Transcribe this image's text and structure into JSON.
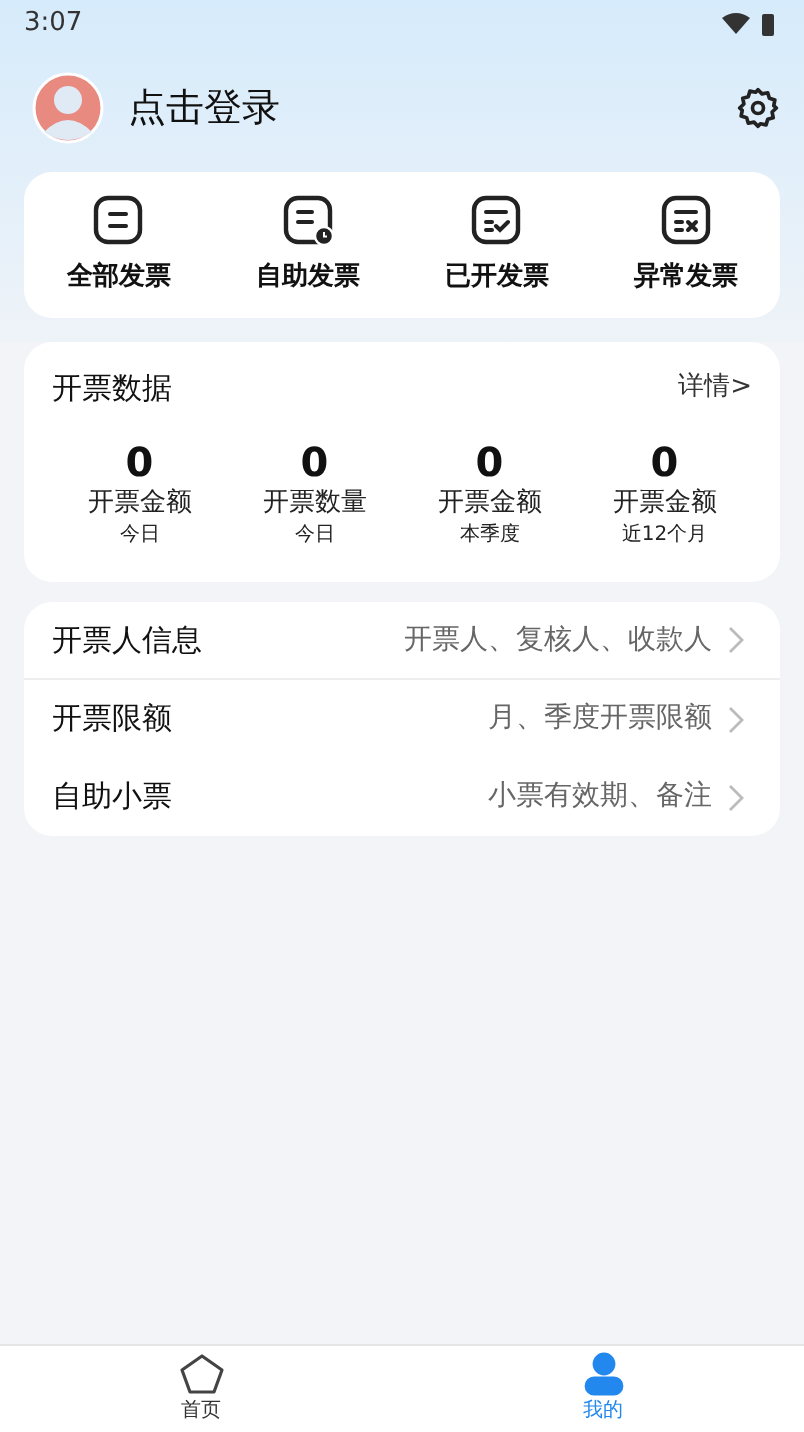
{
  "status_bar": {
    "time": "3:07"
  },
  "header": {
    "login": "点击登录"
  },
  "quick_actions": [
    {
      "label": "全部发票",
      "kind": "all"
    },
    {
      "label": "自助发票",
      "kind": "self"
    },
    {
      "label": "已开发票",
      "kind": "issued"
    },
    {
      "label": "异常发票",
      "kind": "abnormal"
    }
  ],
  "stats_card": {
    "title": "开票数据",
    "details_link": "详情>",
    "stats": [
      {
        "value": "0",
        "label": "开票金额",
        "period": "今日"
      },
      {
        "value": "0",
        "label": "开票数量",
        "period": "今日"
      },
      {
        "value": "0",
        "label": "开票金额",
        "period": "本季度"
      },
      {
        "value": "0",
        "label": "开票金额",
        "period": "近12个月"
      }
    ]
  },
  "settings": [
    {
      "title": "开票人信息",
      "hint": "开票人、复核人、收款人"
    },
    {
      "title": "开票限额",
      "hint": "月、季度开票限额"
    },
    {
      "title": "自助小票",
      "hint": "小票有效期、备注"
    }
  ],
  "tab_bar": [
    {
      "label": "首页",
      "kind": "home",
      "selected": false
    },
    {
      "label": "我的",
      "kind": "me",
      "selected": true
    }
  ]
}
